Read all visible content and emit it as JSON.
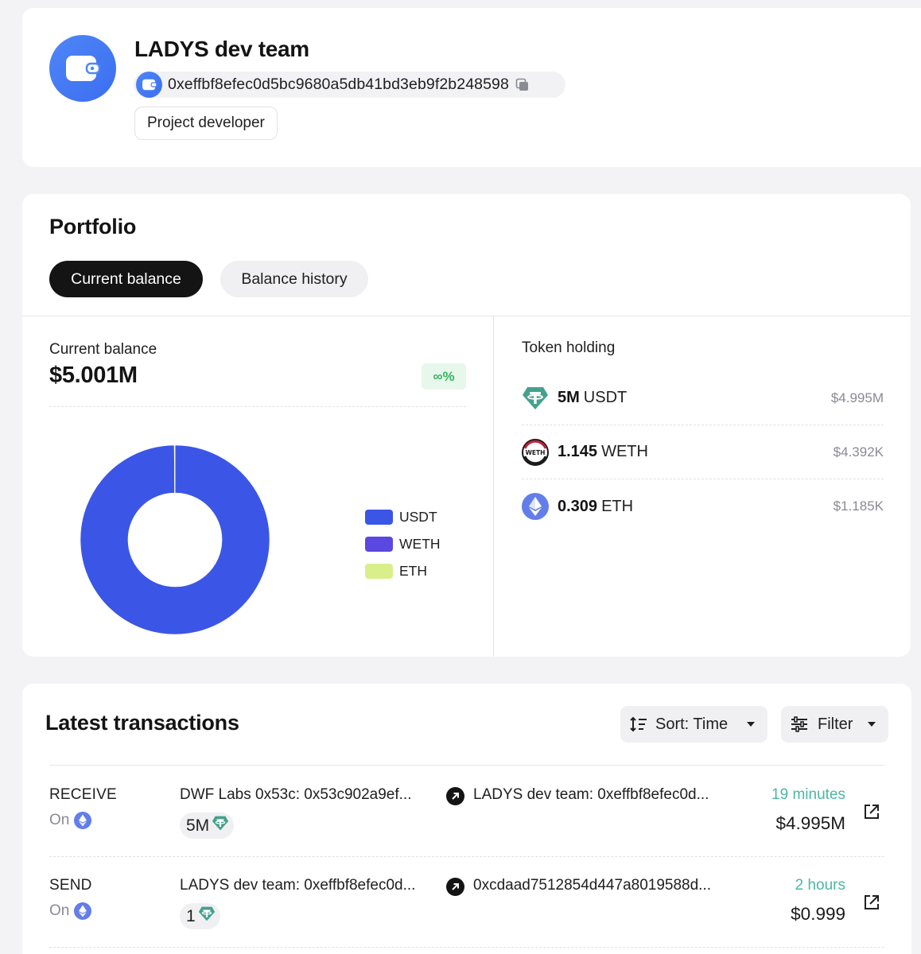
{
  "profile": {
    "name": "LADYS dev team",
    "address": "0xeffbf8efec0d5bc9680a5db41bd3eb9f2b248598",
    "tag": "Project developer"
  },
  "portfolio": {
    "title": "Portfolio",
    "tabs": [
      {
        "label": "Current balance",
        "active": true
      },
      {
        "label": "Balance history",
        "active": false
      }
    ],
    "current_balance_label": "Current balance",
    "current_balance_value": "$5.001M",
    "change_badge": "∞%",
    "token_holding_title": "Token holding",
    "tokens": [
      {
        "amount": "5M",
        "symbol": "USDT",
        "usd": "$4.995M",
        "icon": "usdt-icon"
      },
      {
        "amount": "1.145",
        "symbol": "WETH",
        "usd": "$4.392K",
        "icon": "weth-icon"
      },
      {
        "amount": "0.309",
        "symbol": "ETH",
        "usd": "$1.185K",
        "icon": "eth-icon"
      }
    ],
    "colors": {
      "USDT": "#3b56e6",
      "WETH": "#5a48e0",
      "ETH": "#d9ef8c"
    }
  },
  "chart_data": {
    "type": "pie",
    "categories": [
      "USDT",
      "WETH",
      "ETH"
    ],
    "values": [
      4995000,
      4392,
      1185
    ],
    "legend_placement": "right"
  },
  "transactions": {
    "title": "Latest transactions",
    "sort_label": "Sort: Time",
    "filter_label": "Filter",
    "rows": [
      {
        "type": "RECEIVE",
        "on_label": "On",
        "from": "DWF Labs 0x53c: 0x53c902a9ef...",
        "to": "LADYS dev team: 0xeffbf8efec0d...",
        "amount": "5M",
        "time": "19 minutes",
        "usd": "$4.995M"
      },
      {
        "type": "SEND",
        "on_label": "On",
        "from": "LADYS dev team: 0xeffbf8efec0d...",
        "to": "0xcdaad7512854d447a8019588d...",
        "amount": "1",
        "time": "2 hours",
        "usd": "$0.999"
      }
    ]
  }
}
